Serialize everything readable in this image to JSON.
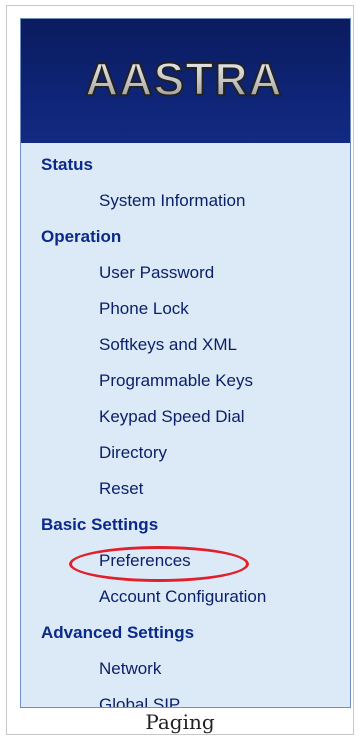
{
  "logo": {
    "text": "AASTRA"
  },
  "nav": {
    "sections": [
      {
        "label": "Status",
        "items": [
          {
            "label": "System Information"
          }
        ]
      },
      {
        "label": "Operation",
        "items": [
          {
            "label": "User Password"
          },
          {
            "label": "Phone Lock"
          },
          {
            "label": "Softkeys and XML"
          },
          {
            "label": "Programmable Keys"
          },
          {
            "label": "Keypad Speed Dial"
          },
          {
            "label": "Directory"
          },
          {
            "label": "Reset"
          }
        ]
      },
      {
        "label": "Basic Settings",
        "items": [
          {
            "label": "Preferences"
          },
          {
            "label": "Account Configuration"
          }
        ]
      },
      {
        "label": "Advanced Settings",
        "items": [
          {
            "label": "Network"
          },
          {
            "label": "Global SIP"
          }
        ]
      }
    ]
  },
  "caption": "Paging",
  "colors": {
    "header_bg": "#0e2476",
    "panel_bg": "#dce9f6",
    "link_text": "#0a1f6a",
    "highlight": "#e0202a"
  }
}
